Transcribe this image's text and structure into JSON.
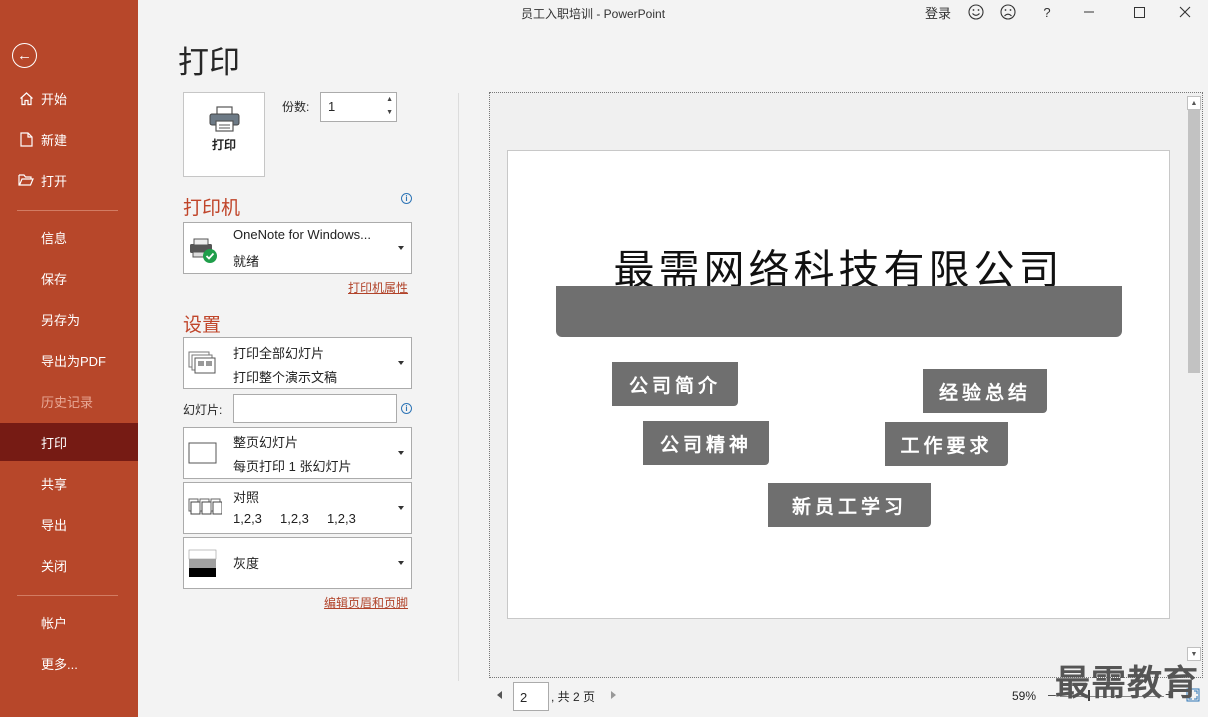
{
  "window": {
    "title": "员工入职培训  -  PowerPoint",
    "signin": "登录",
    "help": "?"
  },
  "sidebar": {
    "items": [
      {
        "label": "开始"
      },
      {
        "label": "新建"
      },
      {
        "label": "打开"
      },
      {
        "label": "信息"
      },
      {
        "label": "保存"
      },
      {
        "label": "另存为"
      },
      {
        "label": "导出为PDF"
      },
      {
        "label": "历史记录"
      },
      {
        "label": "打印"
      },
      {
        "label": "共享"
      },
      {
        "label": "导出"
      },
      {
        "label": "关闭"
      },
      {
        "label": "帐户"
      },
      {
        "label": "更多..."
      }
    ]
  },
  "print": {
    "heading": "打印",
    "button_label": "打印",
    "copies_label": "份数:",
    "copies_value": "1",
    "printer_section": "打印机",
    "printer_name": "OneNote for Windows...",
    "printer_status": "就绪",
    "printer_properties": "打印机属性",
    "settings_section": "设置",
    "range_line1": "打印全部幻灯片",
    "range_line2": "打印整个演示文稿",
    "slides_label": "幻灯片:",
    "slides_value": "",
    "layout_line1": "整页幻灯片",
    "layout_line2": "每页打印 1 张幻灯片",
    "collate_line1": "对照",
    "collate_line2": "1,2,3     1,2,3     1,2,3",
    "color_line1": "灰度",
    "edit_header_footer": "编辑页眉和页脚"
  },
  "slide": {
    "title": "最需网络科技有限公司",
    "tags": [
      "公司简介",
      "经验总结",
      "公司精神",
      "工作要求",
      "新员工学习"
    ]
  },
  "footer": {
    "page_value": "2",
    "page_total": ", 共 2 页",
    "zoom": "59%",
    "watermark": "最需教育"
  },
  "colors": {
    "sidebar": "#b7472a",
    "sidebar_active": "#761b14",
    "accent_text": "#c0452a",
    "slide_shape": "#6f6f6f"
  }
}
